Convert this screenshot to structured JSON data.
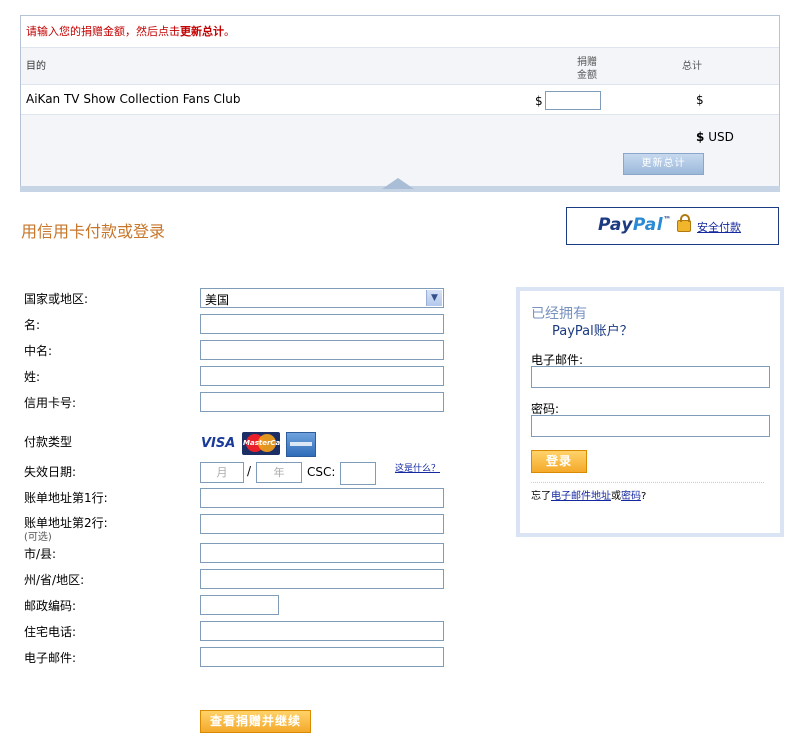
{
  "cart": {
    "instruction_prefix": "请输入您的捐赠金额，然后点击",
    "instruction_bold": "更新总计",
    "instruction_suffix": "。",
    "col_purpose": "目的",
    "col_amount_line1": "捐赠",
    "col_amount_line2": "金额",
    "col_total": "总计",
    "item_name": "AiKan TV Show Collection Fans Club",
    "item_currency_symbol": "$",
    "item_amount_value": "",
    "item_total": "$",
    "grand_total_symbol": "$",
    "grand_total_currency": "USD",
    "update_button": "更新总计"
  },
  "page_title": "用信用卡付款或登录",
  "paypal_badge": {
    "logo_part1": "Pay",
    "logo_part2": "Pal",
    "logo_tm": "™",
    "secure_link": "安全付款",
    "lock_icon": "lock-icon"
  },
  "form": {
    "country_label": "国家或地区:",
    "country_value": "美国",
    "first_name_label": "名:",
    "middle_name_label": "中名:",
    "last_name_label": "姓:",
    "card_number_label": "信用卡号:",
    "payment_type_label": "付款类型",
    "cards": {
      "visa": "VISA",
      "mastercard": "MasterCard"
    },
    "expiry_label": "失效日期:",
    "expiry_month_placeholder": "月",
    "expiry_slash": "/",
    "expiry_year_placeholder": "年",
    "csc_label": "CSC:",
    "whats_this_link": "这是什么？",
    "address1_label": "账单地址第1行:",
    "address2_label": "账单地址第2行:",
    "address2_optional": "(可选)",
    "city_label": "市/县:",
    "state_label": "州/省/地区:",
    "zip_label": "邮政编码:",
    "phone_label": "住宅电话:",
    "email_label": "电子邮件:",
    "continue_button": "查看捐赠并继续"
  },
  "login": {
    "title_line1": "已经拥有",
    "title_line2": "PayPal账户？",
    "email_label": "电子邮件:",
    "password_label": "密码:",
    "login_button": "登录",
    "forgot_prefix": "忘了",
    "forgot_email_link": "电子邮件地址",
    "forgot_or": "或",
    "forgot_password_link": "密码",
    "forgot_suffix": "?"
  },
  "colors": {
    "accent_orange": "#f4a92a",
    "title_orange": "#c8762a",
    "paypal_dark_blue": "#1c3a80",
    "paypal_light_blue": "#2a8ad3",
    "link_blue": "#1428a0",
    "instruction_red": "#c30000"
  }
}
